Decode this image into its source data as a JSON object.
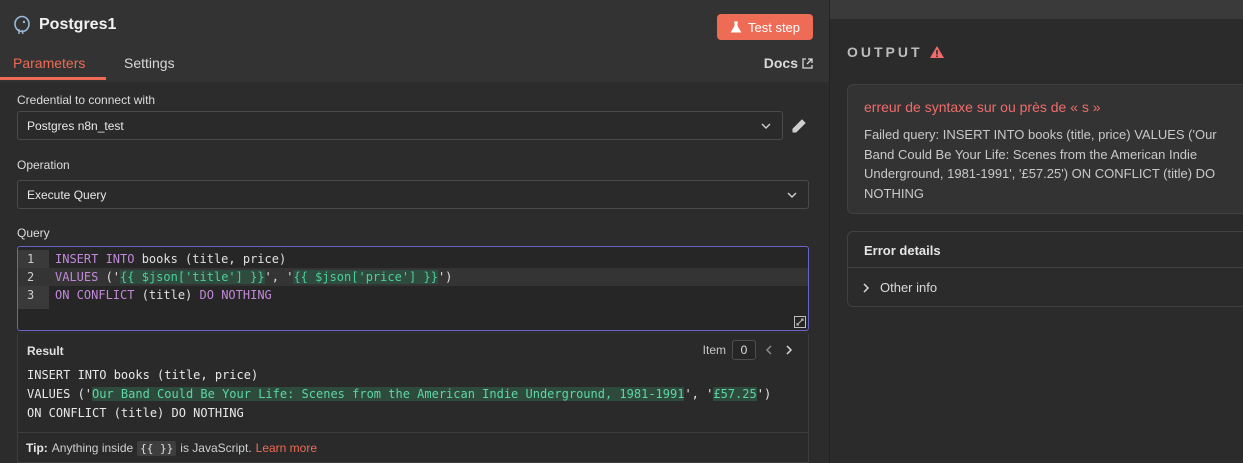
{
  "node": {
    "title": "Postgres1",
    "test_step_label": "Test step"
  },
  "tabs": [
    {
      "label": "Parameters",
      "active": true
    },
    {
      "label": "Settings",
      "active": false
    }
  ],
  "docs_label": "Docs",
  "credential": {
    "label": "Credential to connect with",
    "value": "Postgres n8n_test"
  },
  "operation": {
    "label": "Operation",
    "value": "Execute Query"
  },
  "query": {
    "label": "Query",
    "line_numbers": [
      "1",
      "2",
      "3"
    ],
    "line1": {
      "kw1": "INSERT INTO",
      "rest": " books (title, price)"
    },
    "line2": {
      "kw": "VALUES",
      "p1": " ('",
      "expr1": "{{ $json['title'] }}",
      "p2": "', '",
      "expr2": "{{ $json['price'] }}",
      "p3": "')"
    },
    "line3": {
      "kw1": "ON CONFLICT",
      "mid": " (title) ",
      "kw2": "DO NOTHING"
    }
  },
  "result": {
    "title": "Result",
    "item_label": "Item",
    "item_value": "0",
    "line1": "INSERT INTO books (title, price)",
    "line2": {
      "p1": "VALUES ('",
      "v1": "Our Band Could Be Your Life: Scenes from the American Indie Underground, 1981-1991",
      "p2": "', '",
      "v2": "£57.25",
      "p3": "')"
    },
    "line3": "ON CONFLICT (title) DO NOTHING"
  },
  "tip": {
    "label": "Tip:",
    "text1": "Anything inside",
    "chip": "{{ }}",
    "text2": "is JavaScript.",
    "link": "Learn more"
  },
  "output": {
    "label": "OUTPUT",
    "error_title": "erreur de syntaxe sur ou près de « s »",
    "error_message": "Failed query: INSERT INTO books (title, price) VALUES ('Our Band Could Be Your Life: Scenes from the American Indie Underground, 1981-1991', '£57.25') ON CONFLICT (title) DO NOTHING",
    "details_title": "Error details",
    "other_info": "Other info"
  },
  "colors": {
    "accent": "#ee6b56",
    "error": "#f06c6c",
    "expression": "#4fce9b"
  }
}
